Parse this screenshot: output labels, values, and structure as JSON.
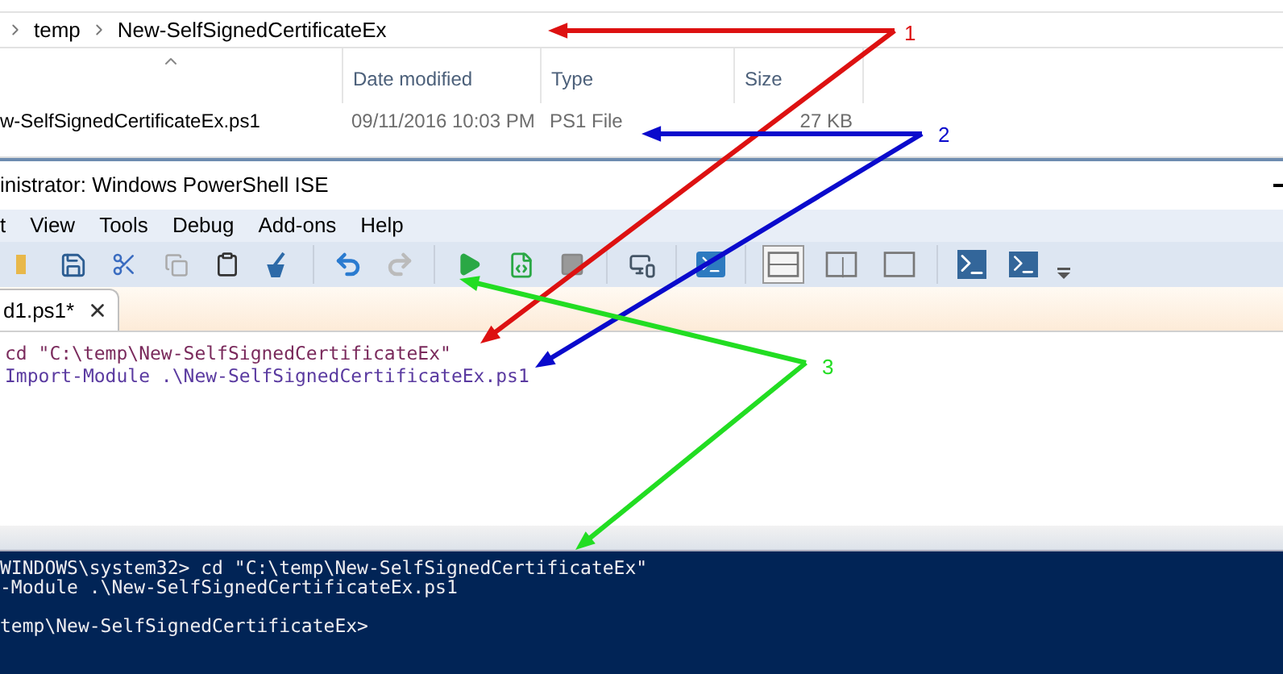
{
  "explorer": {
    "breadcrumb": [
      "temp",
      "New-SelfSignedCertificateEx"
    ],
    "columns": [
      "Date modified",
      "Type",
      "Size"
    ],
    "rows": [
      {
        "name": "w-SelfSignedCertificateEx.ps1",
        "date": "09/11/2016 10:03 PM",
        "type": "PS1 File",
        "size": "27 KB"
      }
    ]
  },
  "ise": {
    "title": "inistrator: Windows PowerShell ISE",
    "menu": [
      "t",
      "View",
      "Tools",
      "Debug",
      "Add-ons",
      "Help"
    ],
    "layout_buttons": [
      {
        "selected": true
      },
      {
        "selected": false
      },
      {
        "selected": false
      }
    ],
    "tabs": [
      {
        "label": "d1.ps1*",
        "selected": true
      }
    ],
    "script_lines": [
      "cd \"C:\\temp\\New-SelfSignedCertificateEx\"",
      "Import-Module .\\New-SelfSignedCertificateEx.ps1"
    ],
    "console_blocks": [
      [
        "WINDOWS\\system32> cd \"C:\\temp\\New-SelfSignedCertificateEx\"",
        "-Module .\\New-SelfSignedCertificateEx.ps1"
      ],
      [
        "temp\\New-SelfSignedCertificateEx>"
      ]
    ]
  },
  "annotations": [
    {
      "label": "1",
      "color": "#dd1111"
    },
    {
      "label": "2",
      "color": "#0a0acc"
    },
    {
      "label": "3",
      "color": "#22dd22"
    }
  ]
}
